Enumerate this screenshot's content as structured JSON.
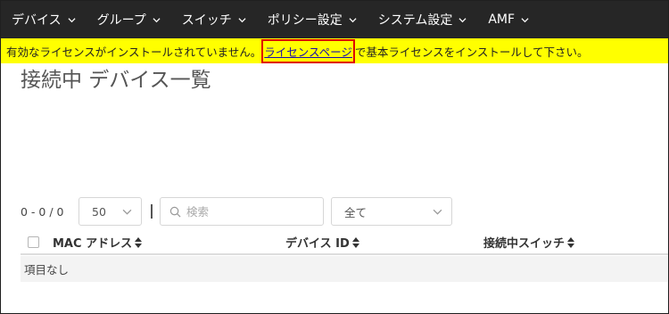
{
  "nav": {
    "items": [
      {
        "label": "デバイス"
      },
      {
        "label": "グループ"
      },
      {
        "label": "スイッチ"
      },
      {
        "label": "ポリシー設定"
      },
      {
        "label": "システム設定"
      },
      {
        "label": "AMF"
      }
    ]
  },
  "banner": {
    "prefix": "有効なライセンスがインストールされていません。",
    "link": "ライセンスページ",
    "suffix": "で基本ライセンスをインストールして下さい。"
  },
  "page": {
    "title": "接続中 デバイス一覧"
  },
  "toolbar": {
    "count": "0 - 0 / 0",
    "page_size": "50",
    "search_placeholder": "検索",
    "filter": "全て"
  },
  "table": {
    "columns": [
      {
        "label": "MAC アドレス"
      },
      {
        "label": "デバイス ID"
      },
      {
        "label": "接続中スイッチ"
      }
    ],
    "empty": "項目なし"
  },
  "colors": {
    "navbar": "#262626",
    "banner": "#ffff00",
    "link_highlight": "#e00000"
  },
  "icons": {
    "nav_chevron": "chevron-down-icon",
    "select_chevron": "chevron-down-icon",
    "search": "search-icon",
    "sort": "sort-icon"
  }
}
